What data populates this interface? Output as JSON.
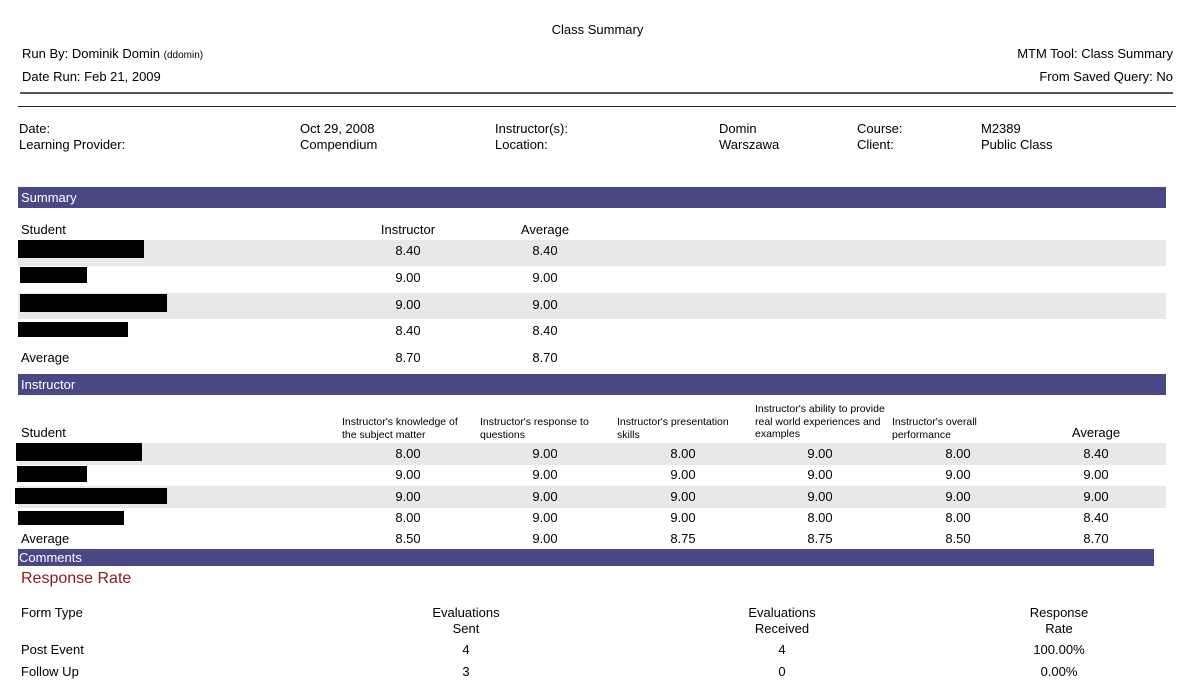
{
  "header": {
    "title": "Class Summary",
    "run_by_label": "Run By: Dominik Domin",
    "run_by_user": "(ddomin)",
    "date_run": "Date Run: Feb 21, 2009",
    "tool": "MTM Tool: Class Summary",
    "saved_query": "From Saved Query: No"
  },
  "info": {
    "date_label": "Date:",
    "date_value": "Oct 29, 2008",
    "provider_label": "Learning Provider:",
    "provider_value": "Compendium",
    "instructor_label": "Instructor(s):",
    "instructor_value": "Domin",
    "location_label": "Location:",
    "location_value": "Warszawa",
    "course_label": "Course:",
    "course_value": "M2389",
    "client_label": "Client:",
    "client_value": "Public Class"
  },
  "summary": {
    "section_title": "Summary",
    "col_student": "Student",
    "col_instructor": "Instructor",
    "col_average": "Average",
    "rows": [
      {
        "instructor": "8.40",
        "average": "8.40"
      },
      {
        "instructor": "9.00",
        "average": "9.00"
      },
      {
        "instructor": "9.00",
        "average": "9.00"
      },
      {
        "instructor": "8.40",
        "average": "8.40"
      }
    ],
    "avg_label": "Average",
    "avg_instructor": "8.70",
    "avg_average": "8.70"
  },
  "instructor": {
    "section_title": "Instructor",
    "col_student": "Student",
    "col_q1": "Instructor's knowledge of the subject matter",
    "col_q2": "Instructor's response to questions",
    "col_q3": "Instructor's presentation skills",
    "col_q4": "Instructor's ability to provide real world experiences and examples",
    "col_q5": "Instructor's overall performance",
    "col_average": "Average",
    "rows": [
      [
        "8.00",
        "9.00",
        "8.00",
        "9.00",
        "8.00",
        "8.40"
      ],
      [
        "9.00",
        "9.00",
        "9.00",
        "9.00",
        "9.00",
        "9.00"
      ],
      [
        "9.00",
        "9.00",
        "9.00",
        "9.00",
        "9.00",
        "9.00"
      ],
      [
        "8.00",
        "9.00",
        "9.00",
        "8.00",
        "8.00",
        "8.40"
      ]
    ],
    "avg_label": "Average",
    "avg_row": [
      "8.50",
      "9.00",
      "8.75",
      "8.75",
      "8.50",
      "8.70"
    ]
  },
  "comments": {
    "section_title": "Comments"
  },
  "response_rate": {
    "title": "Response Rate",
    "col_form_type": "Form Type",
    "col_sent_1": "Evaluations",
    "col_sent_2": "Sent",
    "col_received_1": "Evaluations",
    "col_received_2": "Received",
    "col_rate_1": "Response",
    "col_rate_2": "Rate",
    "rows": [
      {
        "form_type": "Post Event",
        "sent": "4",
        "received": "4",
        "rate": "100.00%"
      },
      {
        "form_type": "Follow Up",
        "sent": "3",
        "received": "0",
        "rate": "0.00%"
      }
    ]
  }
}
